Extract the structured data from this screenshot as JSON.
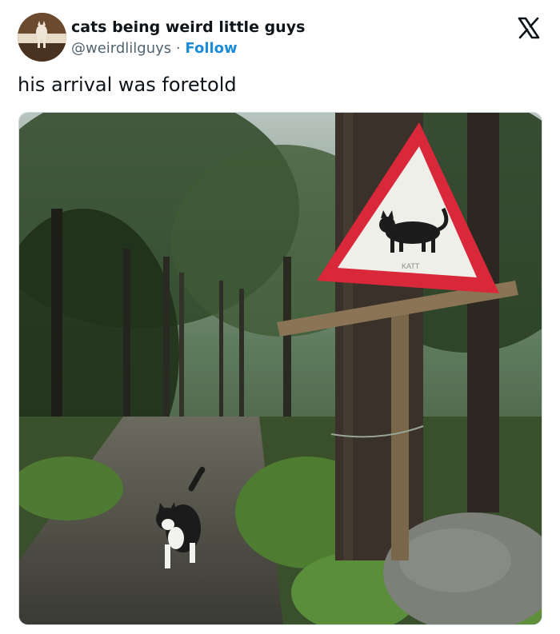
{
  "author": {
    "display_name": "cats being weird little guys",
    "handle": "@weirdlilguys",
    "separator": "·",
    "follow_label": "Follow",
    "avatar_icon": "cat-avatar-icon"
  },
  "platform_icon": "x-logo-icon",
  "tweet": {
    "text": "his arrival was foretold"
  },
  "media": {
    "description_icon": "photo-forest-path-cat-crossing-sign",
    "sign_text": "KATT"
  },
  "colors": {
    "follow_accent": "#1d8cd8",
    "text_primary": "#0f1419",
    "text_secondary": "#536471",
    "sign_red": "#d8283a"
  }
}
